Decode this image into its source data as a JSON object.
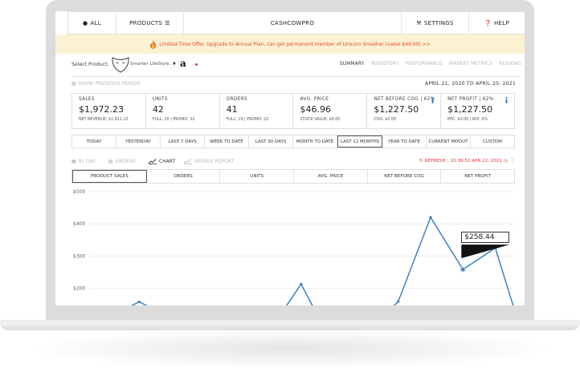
{
  "nav": {
    "all_label": "ALL",
    "products_label": "PRODUCTS",
    "brand": "CASHCOWPRO",
    "settings_label": "SETTINGS",
    "help_label": "HELP"
  },
  "offer": {
    "text": "Limited Time Offer. Upgrade to Annual Plan, can get permanent member of Unicorn Smasher (value $49.99) >>"
  },
  "product": {
    "select_label": "Select Product:",
    "name": "Smarter LifeStyle..",
    "marketplace_letter": "a"
  },
  "tabs": [
    "SUMMARY",
    "INVENTORY",
    "PERFORMANCE",
    "MARKET METRICS",
    "REVIEWS"
  ],
  "active_tab": "SUMMARY",
  "period_header": {
    "show_previous": "SHOW PREVIOUS PERIOD",
    "date_range": "APRIL 21, 2020 TO APRIL 20, 2021"
  },
  "cards": [
    {
      "title": "SALES",
      "value": "$1,972.23",
      "sub": "NET REVENUE: $1,911.13",
      "info": false
    },
    {
      "title": "UNITS",
      "value": "42",
      "sub": "FULL: 20 | PROMO: 22",
      "info": false
    },
    {
      "title": "ORDERS",
      "value": "41",
      "sub": "FULL: 19 | PROMO: 22",
      "info": false
    },
    {
      "title": "AVG. PRICE",
      "value": "$46.96",
      "sub": "STOCK VALUE: $0.00",
      "info": false
    },
    {
      "title": "NET BEFORE COG | 62%",
      "value": "$1,227.50",
      "sub": "COG: $0.00",
      "info": true
    },
    {
      "title": "NET PROFIT | 62%",
      "value": "$1,227.50",
      "sub": "PPC: $0.00 | ROI: 0%",
      "info": true
    }
  ],
  "periods": [
    "TODAY",
    "YESTERDAY",
    "LAST 7 DAYS",
    "WEEK TO DATE",
    "LAST 30 DAYS",
    "MONTH TO DATE",
    "LAST 12 MONTHS",
    "YEAR TO DATE",
    "CURRENT PAYOUT",
    "CUSTOM"
  ],
  "selected_period": "LAST 12 MONTHS",
  "views": {
    "by_day": "BY DAY",
    "orders": "ORDERS",
    "chart": "CHART",
    "weekly_report": "WEEKLY REPORT",
    "refresh": "REFRESH",
    "refresh_time": "15:39:51 APR 22, 2021"
  },
  "metrics": [
    "PRODUCT SALES",
    "ORDERS",
    "UNITS",
    "AVG. PRICE",
    "NET BEFORE COG",
    "NET PROFIT"
  ],
  "selected_metric": "PRODUCT SALES",
  "colors": {
    "line": "#3a80c1",
    "accent_red": "#e2323a",
    "offer_bg": "#fbf1d3",
    "offer_text": "#e24a2c"
  },
  "chart_data": {
    "type": "line",
    "ylim": [
      0,
      500
    ],
    "yticks": [
      "$500",
      "$400",
      "$300",
      "$200",
      "$100"
    ],
    "ytick_values": [
      500,
      400,
      300,
      200,
      100
    ],
    "x": [
      0,
      1,
      2,
      3,
      4,
      5,
      6,
      7,
      8,
      9,
      10,
      11,
      12
    ],
    "values": [
      106,
      158,
      106,
      106,
      66,
      64,
      213,
      22,
      56,
      159,
      420,
      258.44,
      325,
      0
    ],
    "tooltip": {
      "index": 11,
      "label": "$258.44"
    }
  }
}
